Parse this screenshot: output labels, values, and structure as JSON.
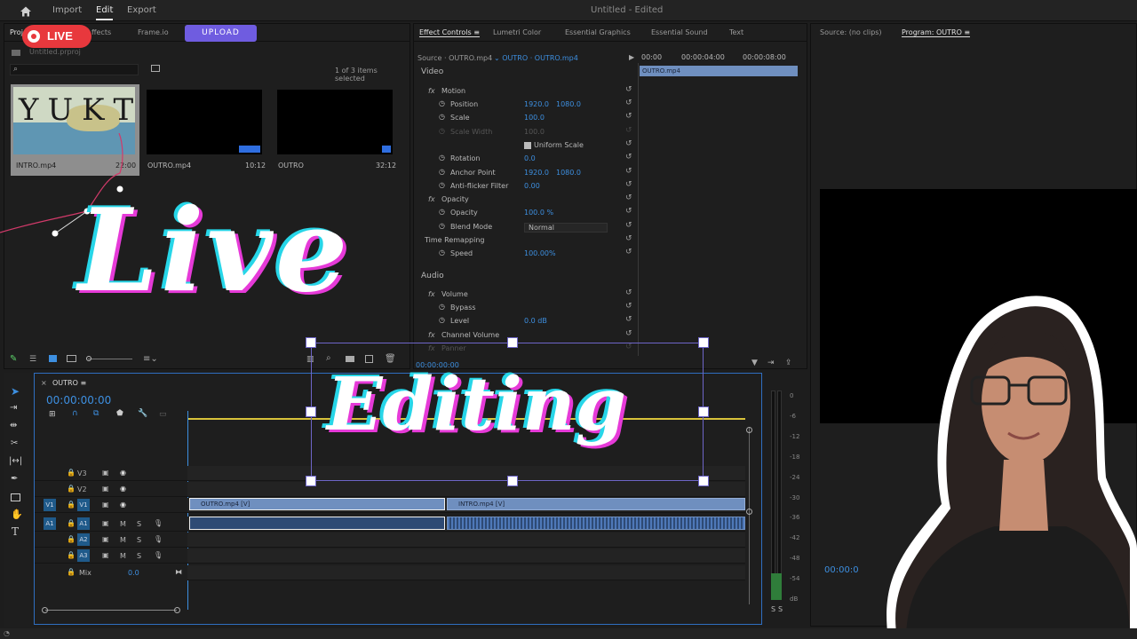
{
  "topbar": {
    "home_icon": "home-icon",
    "menu": [
      "Import",
      "Edit",
      "Export"
    ],
    "active_menu": "Edit",
    "doc_title": "Untitled",
    "doc_status": "- Edited"
  },
  "live_badge": {
    "label": "LIVE",
    "color": "#e8383d"
  },
  "project_panel": {
    "tabs": [
      "Proj",
      "ffects",
      "Frame.io"
    ],
    "upload_label": "UPLOAD",
    "project_file": "Untitled.prproj",
    "selection_status": "1 of 3 items selected",
    "items": [
      {
        "name": "INTRO.mp4",
        "duration": "22:00"
      },
      {
        "name": "OUTRO.mp4",
        "duration": "10:12"
      },
      {
        "name": "OUTRO",
        "duration": "32:12"
      }
    ],
    "thumb_title": "YUKTA"
  },
  "effect_controls": {
    "tabs": [
      "Effect Controls",
      "Lumetri Color",
      "Essential Graphics",
      "Essential Sound",
      "Text"
    ],
    "source_label": "Source · OUTRO.mp4",
    "sequence_label": "OUTRO · OUTRO.mp4",
    "ruler": [
      "00:00",
      "00:00:04:00",
      "00:00:08:00"
    ],
    "clip_bar": "OUTRO.mp4",
    "sections": {
      "video": "Video",
      "audio": "Audio"
    },
    "rows": [
      {
        "label": "Motion",
        "value": "",
        "value2": ""
      },
      {
        "label": "Position",
        "value": "1920.0",
        "value2": "1080.0"
      },
      {
        "label": "Scale",
        "value": "100.0",
        "value2": ""
      },
      {
        "label": "Scale Width",
        "value": "100.0",
        "value2": ""
      },
      {
        "label": "Uniform Scale",
        "value": "",
        "value2": ""
      },
      {
        "label": "Rotation",
        "value": "0.0",
        "value2": ""
      },
      {
        "label": "Anchor Point",
        "value": "1920.0",
        "value2": "1080.0"
      },
      {
        "label": "Anti-flicker Filter",
        "value": "0.00",
        "value2": ""
      },
      {
        "label": "Opacity",
        "value": "",
        "value2": ""
      },
      {
        "label": "Opacity",
        "value": "100.0 %",
        "value2": ""
      },
      {
        "label": "Blend Mode",
        "value": "Normal",
        "value2": ""
      },
      {
        "label": "Time Remapping",
        "value": "",
        "value2": ""
      },
      {
        "label": "Speed",
        "value": "100.00%",
        "value2": ""
      },
      {
        "label": "Volume",
        "value": "",
        "value2": ""
      },
      {
        "label": "Bypass",
        "value": "",
        "value2": ""
      },
      {
        "label": "Level",
        "value": "0.0 dB",
        "value2": ""
      },
      {
        "label": "Channel Volume",
        "value": "",
        "value2": ""
      },
      {
        "label": "Panner",
        "value": "",
        "value2": ""
      }
    ],
    "timecode": "00:00:00:00"
  },
  "program_monitor": {
    "source_tab": "Source: (no clips)",
    "program_tab": "Program: OUTRO",
    "timecode": "00:00:0"
  },
  "timeline": {
    "sequence": "OUTRO",
    "timecode": "00:00:00:00",
    "video_tracks": [
      "V3",
      "V2",
      "V1"
    ],
    "audio_tracks": [
      "A1",
      "A2",
      "A3"
    ],
    "src_v": "V1",
    "src_a": "A1",
    "mix_label": "Mix",
    "mix_value": "0.0",
    "clips": {
      "v1_a": "OUTRO.mp4 [V]",
      "v1_b": "INTRO.mp4 [V]"
    }
  },
  "meters": {
    "ticks": [
      "0",
      "-6",
      "-12",
      "-18",
      "-24",
      "-30",
      "-36",
      "-42",
      "-48",
      "-54",
      "dB"
    ],
    "solo": [
      "S",
      "S"
    ]
  },
  "overlay": {
    "title_line1": "Live",
    "title_line2": "Editing"
  }
}
